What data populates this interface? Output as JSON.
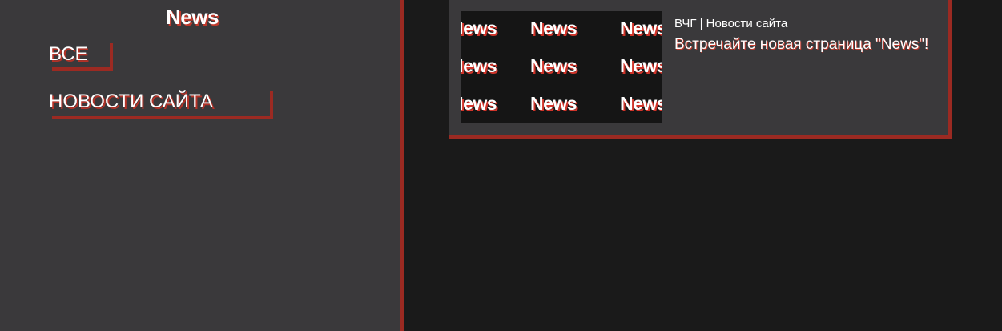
{
  "sidebar": {
    "title": "News",
    "items": [
      {
        "label": "ВСЕ"
      },
      {
        "label": "НОВОСТИ САЙТА"
      }
    ]
  },
  "news": [
    {
      "thumbnail_text": "News",
      "category": "ВЧГ | Новости сайта",
      "headline": "Встречайте новая страница \"News\"!"
    }
  ],
  "colors": {
    "accent": "#9b2a22",
    "panel": "#3a393b",
    "background": "#1a1a1a",
    "text": "#ffffff"
  }
}
